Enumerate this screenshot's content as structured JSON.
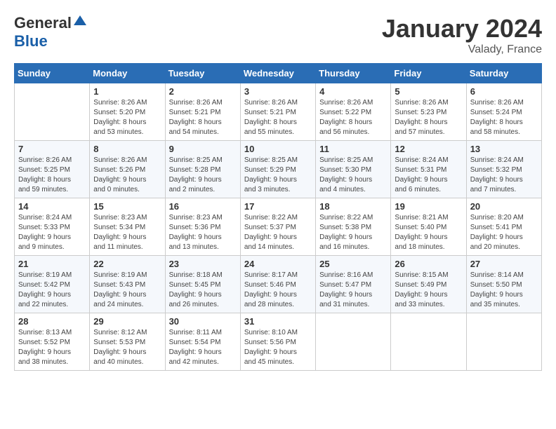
{
  "header": {
    "logo_general": "General",
    "logo_blue": "Blue",
    "month": "January 2024",
    "location": "Valady, France"
  },
  "days_of_week": [
    "Sunday",
    "Monday",
    "Tuesday",
    "Wednesday",
    "Thursday",
    "Friday",
    "Saturday"
  ],
  "weeks": [
    [
      {
        "day": "",
        "info": ""
      },
      {
        "day": "1",
        "info": "Sunrise: 8:26 AM\nSunset: 5:20 PM\nDaylight: 8 hours\nand 53 minutes."
      },
      {
        "day": "2",
        "info": "Sunrise: 8:26 AM\nSunset: 5:21 PM\nDaylight: 8 hours\nand 54 minutes."
      },
      {
        "day": "3",
        "info": "Sunrise: 8:26 AM\nSunset: 5:21 PM\nDaylight: 8 hours\nand 55 minutes."
      },
      {
        "day": "4",
        "info": "Sunrise: 8:26 AM\nSunset: 5:22 PM\nDaylight: 8 hours\nand 56 minutes."
      },
      {
        "day": "5",
        "info": "Sunrise: 8:26 AM\nSunset: 5:23 PM\nDaylight: 8 hours\nand 57 minutes."
      },
      {
        "day": "6",
        "info": "Sunrise: 8:26 AM\nSunset: 5:24 PM\nDaylight: 8 hours\nand 58 minutes."
      }
    ],
    [
      {
        "day": "7",
        "info": "Sunrise: 8:26 AM\nSunset: 5:25 PM\nDaylight: 8 hours\nand 59 minutes."
      },
      {
        "day": "8",
        "info": "Sunrise: 8:26 AM\nSunset: 5:26 PM\nDaylight: 9 hours\nand 0 minutes."
      },
      {
        "day": "9",
        "info": "Sunrise: 8:25 AM\nSunset: 5:28 PM\nDaylight: 9 hours\nand 2 minutes."
      },
      {
        "day": "10",
        "info": "Sunrise: 8:25 AM\nSunset: 5:29 PM\nDaylight: 9 hours\nand 3 minutes."
      },
      {
        "day": "11",
        "info": "Sunrise: 8:25 AM\nSunset: 5:30 PM\nDaylight: 9 hours\nand 4 minutes."
      },
      {
        "day": "12",
        "info": "Sunrise: 8:24 AM\nSunset: 5:31 PM\nDaylight: 9 hours\nand 6 minutes."
      },
      {
        "day": "13",
        "info": "Sunrise: 8:24 AM\nSunset: 5:32 PM\nDaylight: 9 hours\nand 7 minutes."
      }
    ],
    [
      {
        "day": "14",
        "info": "Sunrise: 8:24 AM\nSunset: 5:33 PM\nDaylight: 9 hours\nand 9 minutes."
      },
      {
        "day": "15",
        "info": "Sunrise: 8:23 AM\nSunset: 5:34 PM\nDaylight: 9 hours\nand 11 minutes."
      },
      {
        "day": "16",
        "info": "Sunrise: 8:23 AM\nSunset: 5:36 PM\nDaylight: 9 hours\nand 13 minutes."
      },
      {
        "day": "17",
        "info": "Sunrise: 8:22 AM\nSunset: 5:37 PM\nDaylight: 9 hours\nand 14 minutes."
      },
      {
        "day": "18",
        "info": "Sunrise: 8:22 AM\nSunset: 5:38 PM\nDaylight: 9 hours\nand 16 minutes."
      },
      {
        "day": "19",
        "info": "Sunrise: 8:21 AM\nSunset: 5:40 PM\nDaylight: 9 hours\nand 18 minutes."
      },
      {
        "day": "20",
        "info": "Sunrise: 8:20 AM\nSunset: 5:41 PM\nDaylight: 9 hours\nand 20 minutes."
      }
    ],
    [
      {
        "day": "21",
        "info": "Sunrise: 8:19 AM\nSunset: 5:42 PM\nDaylight: 9 hours\nand 22 minutes."
      },
      {
        "day": "22",
        "info": "Sunrise: 8:19 AM\nSunset: 5:43 PM\nDaylight: 9 hours\nand 24 minutes."
      },
      {
        "day": "23",
        "info": "Sunrise: 8:18 AM\nSunset: 5:45 PM\nDaylight: 9 hours\nand 26 minutes."
      },
      {
        "day": "24",
        "info": "Sunrise: 8:17 AM\nSunset: 5:46 PM\nDaylight: 9 hours\nand 28 minutes."
      },
      {
        "day": "25",
        "info": "Sunrise: 8:16 AM\nSunset: 5:47 PM\nDaylight: 9 hours\nand 31 minutes."
      },
      {
        "day": "26",
        "info": "Sunrise: 8:15 AM\nSunset: 5:49 PM\nDaylight: 9 hours\nand 33 minutes."
      },
      {
        "day": "27",
        "info": "Sunrise: 8:14 AM\nSunset: 5:50 PM\nDaylight: 9 hours\nand 35 minutes."
      }
    ],
    [
      {
        "day": "28",
        "info": "Sunrise: 8:13 AM\nSunset: 5:52 PM\nDaylight: 9 hours\nand 38 minutes."
      },
      {
        "day": "29",
        "info": "Sunrise: 8:12 AM\nSunset: 5:53 PM\nDaylight: 9 hours\nand 40 minutes."
      },
      {
        "day": "30",
        "info": "Sunrise: 8:11 AM\nSunset: 5:54 PM\nDaylight: 9 hours\nand 42 minutes."
      },
      {
        "day": "31",
        "info": "Sunrise: 8:10 AM\nSunset: 5:56 PM\nDaylight: 9 hours\nand 45 minutes."
      },
      {
        "day": "",
        "info": ""
      },
      {
        "day": "",
        "info": ""
      },
      {
        "day": "",
        "info": ""
      }
    ]
  ]
}
